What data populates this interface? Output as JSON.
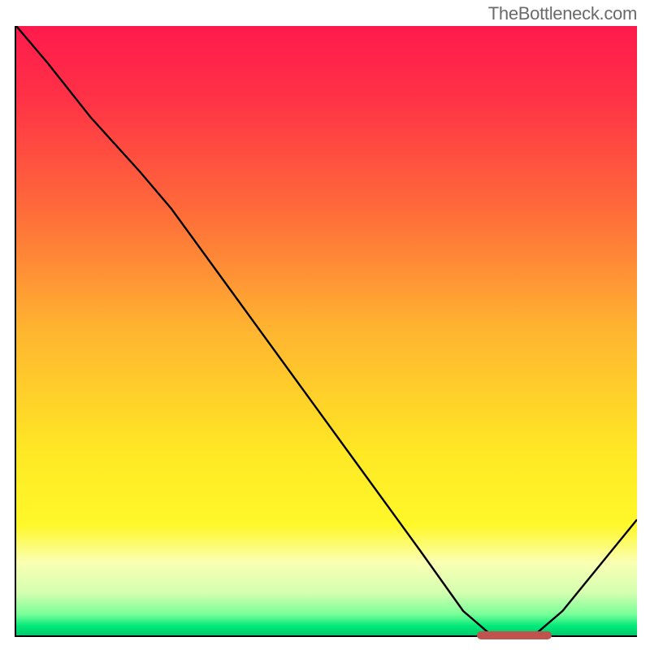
{
  "watermark": "TheBottleneck.com",
  "chart_data": {
    "type": "line",
    "title": "",
    "xlabel": "",
    "ylabel": "",
    "xlim": [
      0,
      100
    ],
    "ylim": [
      0,
      100
    ],
    "grid": false,
    "curve_points": [
      {
        "x": 0,
        "y": 100
      },
      {
        "x": 5,
        "y": 94
      },
      {
        "x": 12,
        "y": 85
      },
      {
        "x": 20,
        "y": 76
      },
      {
        "x": 25,
        "y": 70
      },
      {
        "x": 35,
        "y": 56
      },
      {
        "x": 45,
        "y": 42
      },
      {
        "x": 55,
        "y": 28
      },
      {
        "x": 65,
        "y": 14
      },
      {
        "x": 72,
        "y": 4
      },
      {
        "x": 76,
        "y": 0.5
      },
      {
        "x": 84,
        "y": 0.5
      },
      {
        "x": 88,
        "y": 4
      },
      {
        "x": 100,
        "y": 19
      }
    ],
    "gradient_stops": [
      {
        "offset": 0,
        "color": "#ff1a4d"
      },
      {
        "offset": 0.12,
        "color": "#ff3246"
      },
      {
        "offset": 0.3,
        "color": "#ff6a3a"
      },
      {
        "offset": 0.5,
        "color": "#ffb530"
      },
      {
        "offset": 0.7,
        "color": "#ffe824"
      },
      {
        "offset": 0.82,
        "color": "#fff82a"
      },
      {
        "offset": 0.88,
        "color": "#faffb3"
      },
      {
        "offset": 0.93,
        "color": "#d4ffb0"
      },
      {
        "offset": 0.965,
        "color": "#7aff99"
      },
      {
        "offset": 0.985,
        "color": "#00e878"
      },
      {
        "offset": 1.0,
        "color": "#00c96b"
      }
    ],
    "optimal_zone": {
      "x_start": 74,
      "x_end": 86,
      "color": "#c1534f"
    }
  }
}
